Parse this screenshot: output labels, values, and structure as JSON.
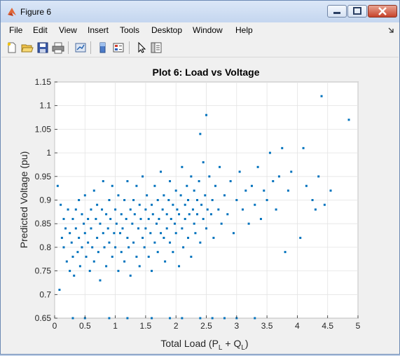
{
  "window": {
    "title": "Figure 6",
    "accent_color": "#0072bd"
  },
  "menubar": {
    "items": [
      "File",
      "Edit",
      "View",
      "Insert",
      "Tools",
      "Desktop",
      "Window",
      "Help"
    ]
  },
  "toolbar": {
    "icons": [
      "new-figure-icon",
      "open-file-icon",
      "save-icon",
      "print-icon",
      "link-plot-icon",
      "insert-colorbar-icon",
      "insert-legend-icon",
      "edit-plot-icon",
      "property-inspector-icon"
    ]
  },
  "chart_data": {
    "type": "scatter",
    "title": "Plot 6: Load vs Voltage",
    "xlabel_main": "Total Load (P",
    "xlabel_sub1": "L",
    "xlabel_mid": " + Q",
    "xlabel_sub2": "L",
    "xlabel_end": ")",
    "ylabel": "Predicted Voltage (pu)",
    "xlim": [
      0,
      5
    ],
    "ylim": [
      0.65,
      1.15
    ],
    "xticks": [
      0,
      0.5,
      1,
      1.5,
      2,
      2.5,
      3,
      3.5,
      4,
      4.5,
      5
    ],
    "xtick_labels": [
      "0",
      "0.5",
      "1",
      "1.5",
      "2",
      "2.5",
      "3",
      "3.5",
      "4",
      "4.5",
      "5"
    ],
    "yticks": [
      0.65,
      0.7,
      0.75,
      0.8,
      0.85,
      0.9,
      0.95,
      1,
      1.05,
      1.1,
      1.15
    ],
    "ytick_labels": [
      "0.65",
      "0.7",
      "0.75",
      "0.8",
      "0.85",
      "0.9",
      "0.95",
      "1",
      "1.05",
      "1.1",
      "1.15"
    ],
    "grid": true,
    "marker_color": "#0072bd",
    "points": [
      [
        0.05,
        0.93
      ],
      [
        0.08,
        0.71
      ],
      [
        0.1,
        0.89
      ],
      [
        0.12,
        0.82
      ],
      [
        0.15,
        0.8
      ],
      [
        0.15,
        0.86
      ],
      [
        0.18,
        0.84
      ],
      [
        0.2,
        0.77
      ],
      [
        0.22,
        0.88
      ],
      [
        0.25,
        0.75
      ],
      [
        0.25,
        0.83
      ],
      [
        0.28,
        0.81
      ],
      [
        0.3,
        0.86
      ],
      [
        0.3,
        0.78
      ],
      [
        0.32,
        0.74
      ],
      [
        0.35,
        0.88
      ],
      [
        0.35,
        0.84
      ],
      [
        0.38,
        0.79
      ],
      [
        0.4,
        0.82
      ],
      [
        0.4,
        0.9
      ],
      [
        0.42,
        0.76
      ],
      [
        0.45,
        0.87
      ],
      [
        0.45,
        0.8
      ],
      [
        0.48,
        0.85
      ],
      [
        0.5,
        0.83
      ],
      [
        0.5,
        0.91
      ],
      [
        0.52,
        0.78
      ],
      [
        0.55,
        0.86
      ],
      [
        0.55,
        0.81
      ],
      [
        0.58,
        0.75
      ],
      [
        0.6,
        0.88
      ],
      [
        0.6,
        0.84
      ],
      [
        0.62,
        0.8
      ],
      [
        0.65,
        0.92
      ],
      [
        0.65,
        0.77
      ],
      [
        0.68,
        0.86
      ],
      [
        0.7,
        0.82
      ],
      [
        0.7,
        0.89
      ],
      [
        0.72,
        0.79
      ],
      [
        0.75,
        0.85
      ],
      [
        0.75,
        0.73
      ],
      [
        0.78,
        0.88
      ],
      [
        0.8,
        0.83
      ],
      [
        0.8,
        0.94
      ],
      [
        0.82,
        0.8
      ],
      [
        0.85,
        0.87
      ],
      [
        0.85,
        0.76
      ],
      [
        0.88,
        0.84
      ],
      [
        0.9,
        0.9
      ],
      [
        0.9,
        0.81
      ],
      [
        0.92,
        0.86
      ],
      [
        0.95,
        0.78
      ],
      [
        0.95,
        0.93
      ],
      [
        0.98,
        0.83
      ],
      [
        1.0,
        0.88
      ],
      [
        1.0,
        0.8
      ],
      [
        1.02,
        0.85
      ],
      [
        1.05,
        0.91
      ],
      [
        1.05,
        0.75
      ],
      [
        1.08,
        0.83
      ],
      [
        1.1,
        0.87
      ],
      [
        1.1,
        0.79
      ],
      [
        1.12,
        0.84
      ],
      [
        1.15,
        0.9
      ],
      [
        1.15,
        0.77
      ],
      [
        1.18,
        0.86
      ],
      [
        1.2,
        0.82
      ],
      [
        1.2,
        0.94
      ],
      [
        1.22,
        0.8
      ],
      [
        1.25,
        0.88
      ],
      [
        1.25,
        0.74
      ],
      [
        1.28,
        0.85
      ],
      [
        1.3,
        0.9
      ],
      [
        1.3,
        0.81
      ],
      [
        1.32,
        0.87
      ],
      [
        1.35,
        0.78
      ],
      [
        1.35,
        0.93
      ],
      [
        1.38,
        0.84
      ],
      [
        1.4,
        0.89
      ],
      [
        1.4,
        0.76
      ],
      [
        1.42,
        0.86
      ],
      [
        1.45,
        0.82
      ],
      [
        1.45,
        0.95
      ],
      [
        1.48,
        0.8
      ],
      [
        1.5,
        0.88
      ],
      [
        1.5,
        0.84
      ],
      [
        1.52,
        0.91
      ],
      [
        1.55,
        0.78
      ],
      [
        1.55,
        0.86
      ],
      [
        1.58,
        0.83
      ],
      [
        1.6,
        0.89
      ],
      [
        1.6,
        0.75
      ],
      [
        1.62,
        0.87
      ],
      [
        1.65,
        0.81
      ],
      [
        1.65,
        0.93
      ],
      [
        1.68,
        0.85
      ],
      [
        1.7,
        0.9
      ],
      [
        1.7,
        0.79
      ],
      [
        1.72,
        0.86
      ],
      [
        1.75,
        0.83
      ],
      [
        1.75,
        0.96
      ],
      [
        1.78,
        0.88
      ],
      [
        1.8,
        0.82
      ],
      [
        1.8,
        0.91
      ],
      [
        1.82,
        0.77
      ],
      [
        1.85,
        0.87
      ],
      [
        1.85,
        0.84
      ],
      [
        1.88,
        0.9
      ],
      [
        1.9,
        0.81
      ],
      [
        1.9,
        0.94
      ],
      [
        1.92,
        0.86
      ],
      [
        1.95,
        0.79
      ],
      [
        1.95,
        0.89
      ],
      [
        1.98,
        0.85
      ],
      [
        2.0,
        0.92
      ],
      [
        2.0,
        0.83
      ],
      [
        2.02,
        0.88
      ],
      [
        2.05,
        0.76
      ],
      [
        2.05,
        0.87
      ],
      [
        2.08,
        0.91
      ],
      [
        2.1,
        0.84
      ],
      [
        2.1,
        0.97
      ],
      [
        2.12,
        0.8
      ],
      [
        2.15,
        0.89
      ],
      [
        2.15,
        0.86
      ],
      [
        2.18,
        0.93
      ],
      [
        2.2,
        0.82
      ],
      [
        2.2,
        0.9
      ],
      [
        2.22,
        0.87
      ],
      [
        2.25,
        0.95
      ],
      [
        2.25,
        0.78
      ],
      [
        2.28,
        0.88
      ],
      [
        2.3,
        0.85
      ],
      [
        2.3,
        0.92
      ],
      [
        2.32,
        0.83
      ],
      [
        2.35,
        0.9
      ],
      [
        2.35,
        0.87
      ],
      [
        2.38,
        0.94
      ],
      [
        2.4,
        0.81
      ],
      [
        2.4,
        1.04
      ],
      [
        2.42,
        0.89
      ],
      [
        2.45,
        0.86
      ],
      [
        2.45,
        0.98
      ],
      [
        2.48,
        0.91
      ],
      [
        2.5,
        0.84
      ],
      [
        2.5,
        1.08
      ],
      [
        2.52,
        0.88
      ],
      [
        2.55,
        0.95
      ],
      [
        2.58,
        0.87
      ],
      [
        2.6,
        0.9
      ],
      [
        2.62,
        0.82
      ],
      [
        2.65,
        0.93
      ],
      [
        2.7,
        0.88
      ],
      [
        2.72,
        0.97
      ],
      [
        2.75,
        0.85
      ],
      [
        2.8,
        0.91
      ],
      [
        2.85,
        0.87
      ],
      [
        2.9,
        0.94
      ],
      [
        2.95,
        0.83
      ],
      [
        3.0,
        0.9
      ],
      [
        3.05,
        0.96
      ],
      [
        3.1,
        0.88
      ],
      [
        3.15,
        0.92
      ],
      [
        3.2,
        0.85
      ],
      [
        3.25,
        0.93
      ],
      [
        3.3,
        0.89
      ],
      [
        3.35,
        0.97
      ],
      [
        3.4,
        0.86
      ],
      [
        3.45,
        0.92
      ],
      [
        3.5,
        0.9
      ],
      [
        3.55,
        1.0
      ],
      [
        3.6,
        0.94
      ],
      [
        3.65,
        0.88
      ],
      [
        3.7,
        0.95
      ],
      [
        3.75,
        1.01
      ],
      [
        3.8,
        0.79
      ],
      [
        3.85,
        0.92
      ],
      [
        3.9,
        0.96
      ],
      [
        4.05,
        0.82
      ],
      [
        4.1,
        1.01
      ],
      [
        4.15,
        0.93
      ],
      [
        4.25,
        0.9
      ],
      [
        4.3,
        0.88
      ],
      [
        4.35,
        0.95
      ],
      [
        4.4,
        1.12
      ],
      [
        4.45,
        0.89
      ],
      [
        4.55,
        0.92
      ],
      [
        4.85,
        1.07
      ],
      [
        0.3,
        0.65
      ],
      [
        0.5,
        0.65
      ],
      [
        0.9,
        0.65
      ],
      [
        1.2,
        0.65
      ],
      [
        1.6,
        0.65
      ],
      [
        1.9,
        0.65
      ],
      [
        2.1,
        0.65
      ],
      [
        2.4,
        0.65
      ],
      [
        2.6,
        0.65
      ],
      [
        2.8,
        0.65
      ],
      [
        3.0,
        0.65
      ],
      [
        3.3,
        0.65
      ]
    ]
  }
}
